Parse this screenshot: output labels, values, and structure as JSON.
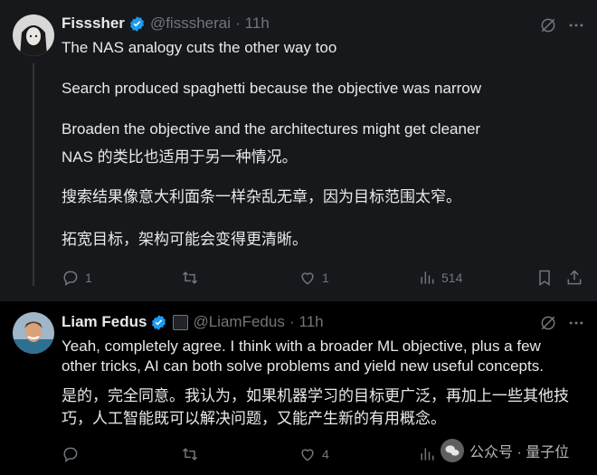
{
  "tweets": [
    {
      "name": "Fisssher",
      "handle": "@fisssherai",
      "dot": "·",
      "time": "11h",
      "lines": [
        "The NAS analogy cuts the other way too",
        "Search produced spaghetti because the objective was narrow",
        "Broaden the objective and the architectures might get cleaner",
        "NAS 的类比也适用于另一种情况。",
        "搜索结果像意大利面条一样杂乱无章，因为目标范围太窄。",
        "拓宽目标，架构可能会变得更清晰。"
      ],
      "replies": "1",
      "reposts": "",
      "likes": "1",
      "views": "514"
    },
    {
      "name": "Liam Fedus",
      "handle": "@LiamFedus",
      "dot": "·",
      "time": "11h",
      "lines": [
        "Yeah, completely agree. I think with a broader ML objective, plus a few",
        "other tricks, AI can both solve problems and yield new useful concepts.",
        "是的，完全同意。我认为，如果机器学习的目标更广泛，再加上一些其他技",
        "巧，人工智能既可以解决问题，又能产生新的有用概念。"
      ],
      "replies": "",
      "reposts": "",
      "likes": "4",
      "views": ""
    }
  ],
  "watermark": {
    "text": "公众号 · 量子位"
  },
  "colors": {
    "verified": "#1d9bf0",
    "muted": "#71767b",
    "text": "#e7e9ea",
    "highlight_bg": "#16181c"
  },
  "icons": [
    "reply-icon",
    "repost-icon",
    "like-icon",
    "views-icon",
    "bookmark-icon",
    "share-icon",
    "grok-icon",
    "more-icon",
    "verified-icon"
  ]
}
